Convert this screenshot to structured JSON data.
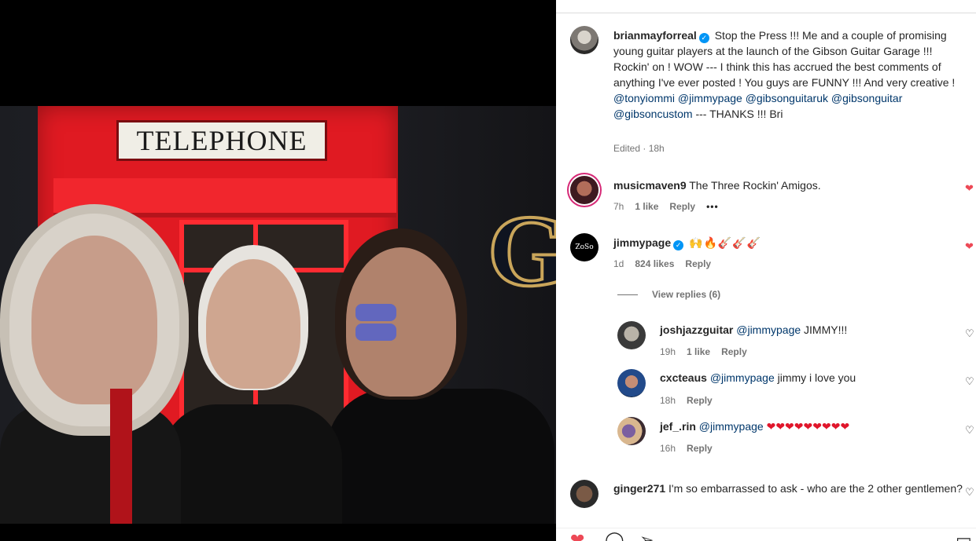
{
  "photo": {
    "sign_text": "TELEPHONE",
    "logo_letter": "G"
  },
  "caption": {
    "username": "brianmayforreal",
    "text_before": "Stop the Press !!! Me and a couple of promising young guitar players at the launch of the Gibson Guitar Garage !!! Rockin' on ! WOW --- I think this has accrued the best comments of anything I've ever posted ! You guys are FUNNY !!! And very creative ! ",
    "mentions": [
      "@tonyiommi",
      "@jimmypage",
      "@gibsonguitaruk",
      "@gibsonguitar",
      "@gibsoncustom"
    ],
    "text_after": " --- THANKS !!! Bri",
    "meta": "Edited · 18h"
  },
  "comments": [
    {
      "username": "musicmaven9",
      "text": "The Three Rockin' Amigos.",
      "time": "7h",
      "likes": "1 like",
      "reply": "Reply",
      "more": "•••"
    },
    {
      "username": "jimmypage",
      "avatar_text": "ZoSo",
      "text": "🙌🔥🎸🎸🎸",
      "time": "1d",
      "likes": "824 likes",
      "reply": "Reply"
    }
  ],
  "view_replies": "View replies (6)",
  "replies": [
    {
      "username": "joshjazzguitar",
      "mention": "@jimmypage",
      "text": "JIMMY!!!",
      "time": "19h",
      "likes": "1 like",
      "reply": "Reply"
    },
    {
      "username": "cxcteaus",
      "mention": "@jimmypage",
      "text": "jimmy i love you",
      "time": "18h",
      "reply": "Reply"
    },
    {
      "username": "jef_.rin",
      "mention": "@jimmypage",
      "text": "❤❤❤❤❤❤❤❤❤",
      "time": "16h",
      "reply": "Reply"
    }
  ],
  "last_comment": {
    "username": "ginger271",
    "text": "I'm so embarrassed to ask - who are the 2 other gentlemen?"
  },
  "colors": {
    "link": "#00376b",
    "meta": "#737373",
    "like_red": "#ed4956",
    "verified": "#0095f6"
  }
}
